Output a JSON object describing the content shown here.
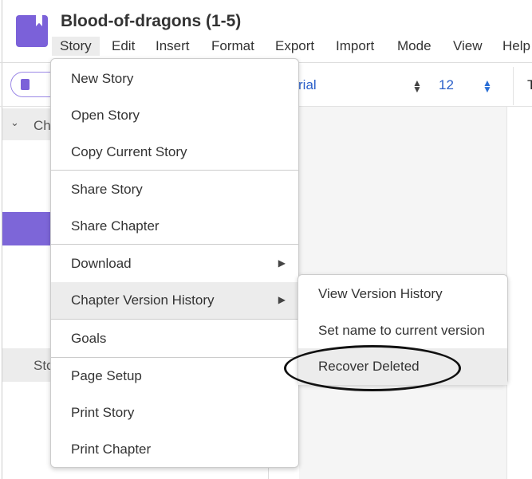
{
  "app": {
    "title": "Blood-of-dragons (1-5)"
  },
  "menubar": [
    "Story",
    "Edit",
    "Insert",
    "Format",
    "Export",
    "Import",
    "Mode",
    "View",
    "Help"
  ],
  "toolbar": {
    "font": "Arial",
    "font_visible": "rial",
    "size": "12",
    "partial": "T"
  },
  "sidebar": {
    "chapters_label": "Ch",
    "stories_label": "Sto"
  },
  "story_menu": {
    "items": [
      "New Story",
      "Open Story",
      "Copy Current Story",
      "Share Story",
      "Share Chapter",
      "Download",
      "Chapter Version History",
      "Goals",
      "Page Setup",
      "Print Story",
      "Print Chapter"
    ]
  },
  "submenu": {
    "items": [
      "View Version History",
      "Set name to current version",
      "Recover Deleted"
    ]
  },
  "colors": {
    "accent": "#7b61d9",
    "link": "#2a5fc9"
  }
}
